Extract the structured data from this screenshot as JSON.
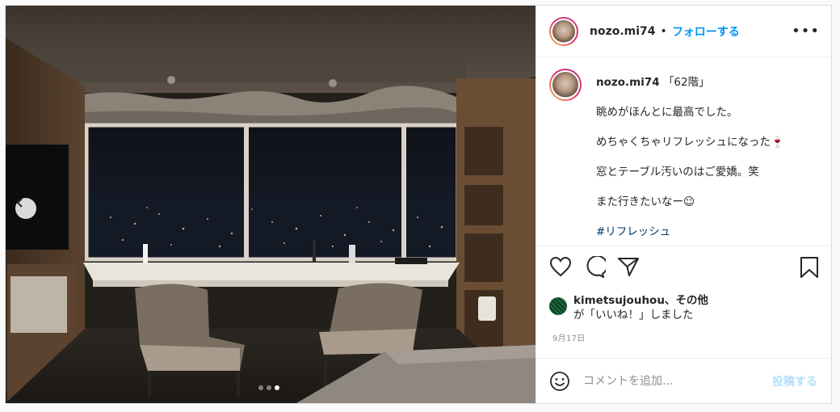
{
  "post": {
    "username": "nozo.mi74",
    "separator": "•",
    "follow_label": "フォローする",
    "more_label": "•••",
    "photo_alt": "",
    "carousel": {
      "count": 3,
      "active": 2
    }
  },
  "caption": {
    "username": "nozo.mi74",
    "title": "「62階」",
    "lines": [
      "眺めがほんとに最高でした。",
      "めちゃくちゃリフレッシュになった🍷",
      "窓とテーブル汚いのはご愛嬌。笑",
      "また行きたいなー☺",
      "#リフレッシュ"
    ]
  },
  "likes": {
    "user": "kimetsujouhou、",
    "others": "その他",
    "suffix": "が「いいね！」しました"
  },
  "date": "9月17日",
  "comment": {
    "placeholder": "コメントを追加...",
    "post_label": "投稿する"
  },
  "colors": {
    "accent": "#0095f6",
    "post_disabled": "#b2dffc",
    "text": "#262626",
    "muted": "#8e8e8e"
  }
}
